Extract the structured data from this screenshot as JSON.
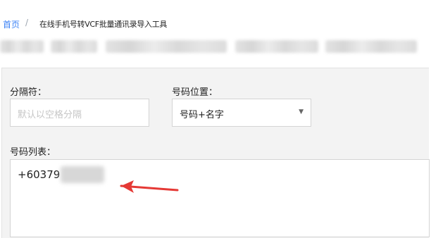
{
  "breadcrumb": {
    "home": "首页",
    "separator": "/",
    "current": "在线手机号转VCF批量通讯录导入工具"
  },
  "form": {
    "separator_label": "分隔符：",
    "separator_placeholder": "默认以空格分隔",
    "position_label": "号码位置：",
    "position_value": "号码+名字",
    "list_label": "号码列表：",
    "list_value_visible": "+60379"
  },
  "icons": {
    "dropdown_caret": "chevron-down-icon",
    "annotation_arrow": "red-arrow-icon"
  },
  "colors": {
    "link": "#3b82f6",
    "arrow": "#e53935"
  }
}
